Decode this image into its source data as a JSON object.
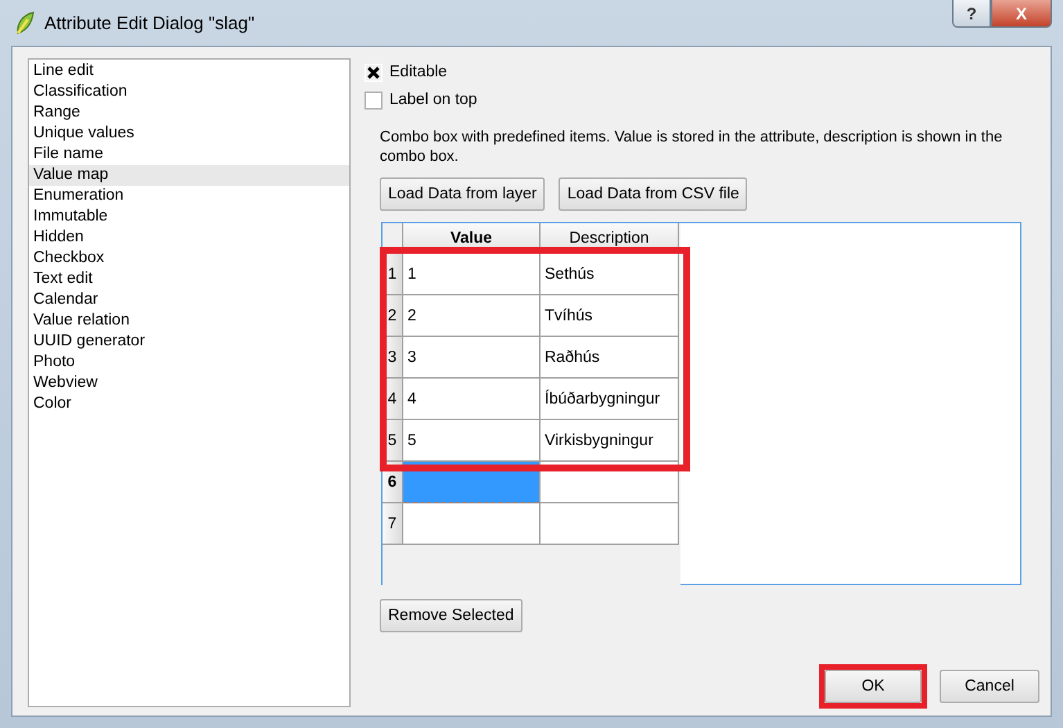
{
  "window": {
    "title": "Attribute Edit Dialog \"slag\"",
    "buttons": [
      {
        "kind": "help",
        "label": "?"
      },
      {
        "kind": "close",
        "label": "X"
      }
    ]
  },
  "widget_types": [
    {
      "label": "Line edit",
      "selected": false
    },
    {
      "label": "Classification",
      "selected": false
    },
    {
      "label": "Range",
      "selected": false
    },
    {
      "label": "Unique values",
      "selected": false
    },
    {
      "label": "File name",
      "selected": false
    },
    {
      "label": "Value map",
      "selected": true
    },
    {
      "label": "Enumeration",
      "selected": false
    },
    {
      "label": "Immutable",
      "selected": false
    },
    {
      "label": "Hidden",
      "selected": false
    },
    {
      "label": "Checkbox",
      "selected": false
    },
    {
      "label": "Text edit",
      "selected": false
    },
    {
      "label": "Calendar",
      "selected": false
    },
    {
      "label": "Value relation",
      "selected": false
    },
    {
      "label": "UUID generator",
      "selected": false
    },
    {
      "label": "Photo",
      "selected": false
    },
    {
      "label": "Webview",
      "selected": false
    },
    {
      "label": "Color",
      "selected": false
    }
  ],
  "options": [
    {
      "label": "Editable",
      "checked": true
    },
    {
      "label": "Label on top",
      "checked": false
    }
  ],
  "description": "Combo box with predefined items. Value is stored in the attribute, description is shown in the combo box.",
  "load_buttons": [
    "Load Data from layer",
    "Load Data from CSV file"
  ],
  "table": {
    "columns": [
      "Value",
      "Description"
    ],
    "rows": [
      {
        "header": "1",
        "value": "1",
        "description": "Sethús",
        "selected": false
      },
      {
        "header": "2",
        "value": "2",
        "description": "Tvíhús",
        "selected": false
      },
      {
        "header": "3",
        "value": "3",
        "description": "Raðhús",
        "selected": false
      },
      {
        "header": "4",
        "value": "4",
        "description": "Íbúðarbygningur",
        "selected": false
      },
      {
        "header": "5",
        "value": "5",
        "description": "Virkisbygningur",
        "selected": false
      },
      {
        "header": "6",
        "value": "",
        "description": "",
        "selected": true
      },
      {
        "header": "7",
        "value": "",
        "description": "",
        "selected": false
      }
    ]
  },
  "remove_button": "Remove Selected",
  "dialog_buttons": [
    {
      "label": "OK",
      "highlighted": true
    },
    {
      "label": "Cancel",
      "highlighted": false
    }
  ]
}
